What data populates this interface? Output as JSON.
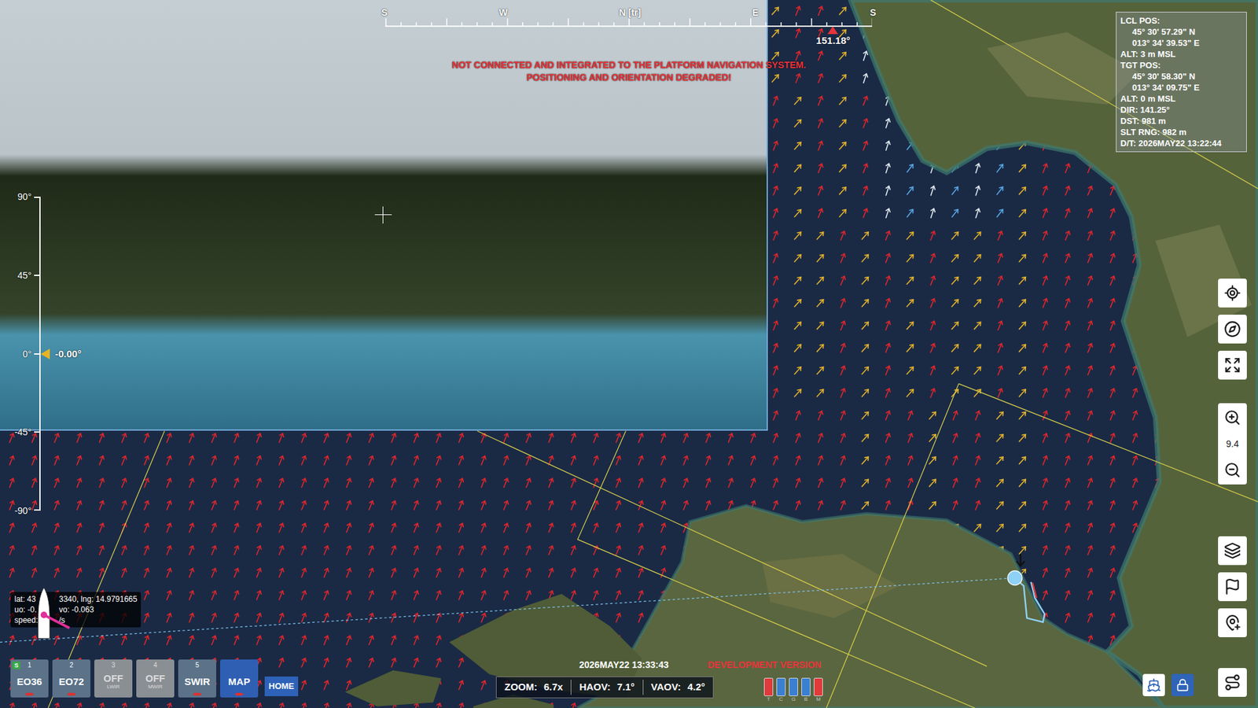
{
  "camera_view": {
    "compass": {
      "labels": [
        "S",
        "W",
        "N [tr]",
        "E",
        "S"
      ],
      "heading": "151.18°",
      "level": 0.92
    },
    "warning": [
      "NOT CONNECTED AND INTEGRATED TO THE PLATFORM NAVIGATION SYSTEM.",
      "POSITIONING AND ORIENTATION DEGRADED!"
    ],
    "elevation": {
      "ticks": [
        "90°",
        "45°",
        "0°",
        "-45°",
        "-90°"
      ],
      "reading": "-0.00°",
      "level": 0.5
    }
  },
  "info_panel": {
    "lines": [
      {
        "text": "LCL POS:",
        "kind": "label"
      },
      {
        "text": "45° 30' 57.29\" N",
        "kind": "indent"
      },
      {
        "text": "013° 34' 39.53\" E",
        "kind": "indent"
      },
      {
        "text": "ALT: 3 m MSL",
        "kind": "label"
      },
      {
        "text": "TGT POS:",
        "kind": "label"
      },
      {
        "text": "45° 30' 58.30\" N",
        "kind": "indent"
      },
      {
        "text": "013° 34' 09.75\" E",
        "kind": "indent"
      },
      {
        "text": "ALT: 0 m MSL",
        "kind": "label"
      },
      {
        "text": "DIR: 141.25°",
        "kind": "label"
      },
      {
        "text": "DST: 981 m",
        "kind": "label"
      },
      {
        "text": "SLT RNG: 982 m",
        "kind": "label"
      },
      {
        "text": "D/T: 2026MAY22 13:22:44",
        "kind": "label"
      }
    ]
  },
  "map_controls": {
    "zoom_level": "9.4"
  },
  "sensor_tabs": [
    {
      "number": "1",
      "label": "EO36",
      "sub": "",
      "badge": "S",
      "disabled": false,
      "selected": false,
      "recording": true
    },
    {
      "number": "2",
      "label": "EO72",
      "sub": "",
      "badge": "",
      "disabled": false,
      "selected": false,
      "recording": true
    },
    {
      "number": "3",
      "label": "OFF",
      "sub": "LWIR",
      "badge": "",
      "disabled": true,
      "selected": false,
      "recording": false
    },
    {
      "number": "4",
      "label": "OFF",
      "sub": "MWIR",
      "badge": "",
      "disabled": true,
      "selected": false,
      "recording": false
    },
    {
      "number": "5",
      "label": "SWIR",
      "sub": "",
      "badge": "",
      "disabled": false,
      "selected": false,
      "recording": true
    },
    {
      "number": "",
      "label": "MAP",
      "sub": "",
      "badge": "",
      "disabled": false,
      "selected": true,
      "recording": true
    }
  ],
  "home_button": "HOME",
  "clock": "2026MAY22 13:33:43",
  "build_label": "DEVELOPMENT VERSION",
  "status_bar": [
    {
      "label": "ZOOM:",
      "value": "6.7x"
    },
    {
      "label": "HAOV:",
      "value": "7.1°"
    },
    {
      "label": "VAOV:",
      "value": "4.2°"
    }
  ],
  "indicators": [
    {
      "letter": "T",
      "color": "#e03a3a"
    },
    {
      "letter": "C",
      "color": "#3b7fd0"
    },
    {
      "letter": "G",
      "color": "#3b7fd0"
    },
    {
      "letter": "B",
      "color": "#3b7fd0"
    },
    {
      "letter": "M",
      "color": "#e03a3a"
    }
  ],
  "boat_tooltip": {
    "lines": [
      [
        "lat: 43",
        "3340, lng: 14.9791665"
      ],
      [
        "uo: -0.",
        "vo: -0.063"
      ],
      [
        "speed:",
        "/s"
      ]
    ]
  },
  "map": {
    "wind_legend": {
      "r": {
        "color": "#e3262b",
        "angle": 22
      },
      "y": {
        "color": "#e9b52a",
        "angle": 42
      },
      "w": {
        "color": "#e4ecf2",
        "angle": 18
      },
      "b": {
        "color": "#5aa7e6",
        "angle": 38
      }
    },
    "wind_rows": [
      "rrrrrrrrrrrrrrrrrrrrrrrrrrrrrrrrrryrrywrbwbwbrrrrrrrrrrr",
      "rrrrrrrrrrrrrrrrrrrrrrrrrrrrrrrrrryrrywrbwbwbrrrrrrrrrrr",
      "rrrrrrrrrrrrrrrrrrrrrrrrrrrrrrrrrryrrywrbwbwbrrrrrrrrrrr",
      "rrrrrrrrrrrrrrrrrrrrrrrrrrrrrrrrrryrrywrbwbwbrrrrrrrrrrr",
      "rrrrrrrrrrrrrrrrrrrrrrrrrrrrrrrrrrryryrwbwbwbyrrrrrrrrrr",
      "rrrrrrrrrrrrrrrrrrrrrrrrrrrrrrrrrrryryrwbwbwbyrrrrrrrrrr",
      "rrrrrrrrrrrrrrrrrrrrrrrrrrrrrrrrrrryryrwbwbwbyrrrrrrrrrr",
      "rrrrrrrrrrrrrrrrrrrrrrrrrrrrrrrrrrryryrwbwbwbyrrrrrrrrrr",
      "rrrrrrrrrrrrrrrrrrrrrrrrrrrrrrrrrrryryrwbwbwbyrrrrrrrrrr",
      "rrrrrrrrrrrrrrrrrrrrrrrrrrrrrrrrrrryryrwbwbwbyrrrrrrrrrr",
      "rrrrrrrrrrrrrrrrrrrrrrrrrrrrrrrrrrryyryryryyryrrrrrrrrrr",
      "rrrrrrrrrrrrrrrrrrrrrrrrrrrrrrrrrrryyryryryyryrrrrrrrrrr",
      "rrrrrrrrrrrrrrrrrrrrrrrrrrrrrrrrrrryyryryryyryrrrrrrrrrr",
      "rrrrrrrrrrrrrrrrrrrrrrrrrrrrrrrrrrryyryryryyryrrrrrrrrrr",
      "rrrrrrrrrrrrrrrrrrrrrrrrrrrrrrrrrrryyryryryyryrrrrrrrrrr",
      "rrrrrrrrrrrrrrrrrrrrrrrrrrrrrrrrrrryyryryryyryrrrrrrrrrr",
      "rrrrrrrrrrrrrrrrrrrrrrrrrrrrrrrrrrryyryryryyryrrrrrrrrrr",
      "rrrrrrrrrrrrrrrrrrrrrrrrrrrrrrrrrrryyryryryyryrrrrrrrrrr",
      "rrrrrrrrrrrrrrrrrrrrrrrrrrrrrrrrrrrrrryrryrryyrrrrrrrrrr",
      "rrrrrrrrrrrrrrrrrrrrrrrrrrrrrrrrrrrrrryrryrryyrrrrrrrrrr",
      "rrrrrrrrrrrrrrrrrrrrrrrrrrrrrrrrrrrrrryrryrryyrrrrrrrrrr",
      "rrrrrrrrrrrrrrrrrrrrrrrrrrrrrrrrrrrrrryrryrryyrrrrrrrrrr",
      "rrrrrrrrrrrrrrrrrrrrrrrrrrrrrrrrrrrrrryrryrryyrrrrrrrrrr",
      "rrrrrrrrrrrrrrrrrrrrrrrrrrrrrrrrrrrrrrrryryyyyrrrrrrrrrr",
      "rrrrrrrrrrrrrrrrrrrrrrrrrrrrrrrrrrrrrrrryryyyyrrrrrrrrrr",
      "rrrrrrrrrrrrrrrrrrrrrrrrrrrrrrrrrrrrrrrryryyyyrrrrrrrrrr",
      "rrrrrrrrrrrrrrrrrrrrrrrrrrrrrrrrrrrrrrrryryyyyrrrrrrrrrr",
      "rrrrrrrrrrrrrrrrrrrrrrrrrrrrrrrrrrrrrrrryryyyyrrrrrrrrrr",
      "rrrrrrrrrrrrrrrrrrrrrrrrrrrrrrrrrrrrrrrryryyyyrrrrrrrrrr",
      "rrrrrrrrrrrrrrrrrrrrrrrrrrrrrrrrrrrrrrrryryyyyrrrrrrrrrr",
      "rrrrrrrrrrrrrrrrrrrrrrrrrrrrrrrrrrrrrrrryryyyyrrrrrrrrrr",
      "rrrrrrrrrrrrrrrrrrrrrrrrrrrrrrrrrrrrrrrryryyyyrrrrrrrrrr"
    ]
  }
}
